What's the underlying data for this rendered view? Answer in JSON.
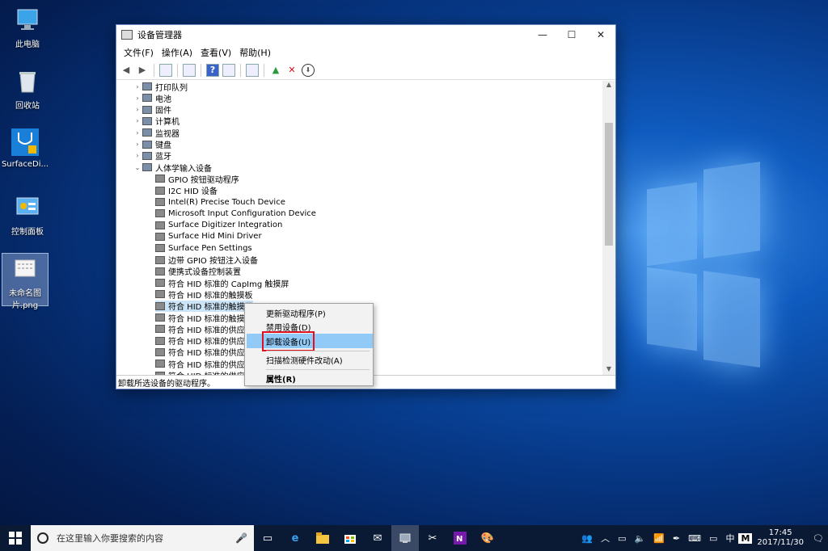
{
  "desktop": {
    "icons": [
      {
        "label": "此电脑",
        "icon": "computer-icon"
      },
      {
        "label": "回收站",
        "icon": "recycle-bin-icon"
      },
      {
        "label": "SurfaceDi...",
        "icon": "stethoscope-icon"
      },
      {
        "label": "控制面板",
        "icon": "control-panel-icon"
      },
      {
        "label": "未命名图片.png",
        "icon": "image-file-icon"
      }
    ]
  },
  "window": {
    "title": "设备管理器",
    "controls": {
      "minimize": "—",
      "maximize": "☐",
      "close": "✕"
    },
    "menu": [
      "文件(F)",
      "操作(A)",
      "查看(V)",
      "帮助(H)"
    ],
    "tree": [
      {
        "label": "打印队列",
        "level": 1,
        "expanded": false
      },
      {
        "label": "电池",
        "level": 1,
        "expanded": false
      },
      {
        "label": "固件",
        "level": 1,
        "expanded": false
      },
      {
        "label": "计算机",
        "level": 1,
        "expanded": false
      },
      {
        "label": "监视器",
        "level": 1,
        "expanded": false
      },
      {
        "label": "键盘",
        "level": 1,
        "expanded": false
      },
      {
        "label": "蓝牙",
        "level": 1,
        "expanded": false
      },
      {
        "label": "人体学输入设备",
        "level": 1,
        "expanded": true
      },
      {
        "label": "GPIO 按钮驱动程序",
        "level": 2
      },
      {
        "label": "I2C HID 设备",
        "level": 2
      },
      {
        "label": "Intel(R) Precise Touch Device",
        "level": 2
      },
      {
        "label": "Microsoft Input Configuration Device",
        "level": 2
      },
      {
        "label": "Surface Digitizer Integration",
        "level": 2
      },
      {
        "label": "Surface Hid Mini Driver",
        "level": 2
      },
      {
        "label": "Surface Pen Settings",
        "level": 2
      },
      {
        "label": "边带 GPIO 按钮注入设备",
        "level": 2
      },
      {
        "label": "便携式设备控制装置",
        "level": 2
      },
      {
        "label": "符合 HID 标准的 CapImg 触摸屏",
        "level": 2
      },
      {
        "label": "符合 HID 标准的触摸板",
        "level": 2
      },
      {
        "label": "符合 HID 标准的触摸屏",
        "level": 2,
        "selected": true
      },
      {
        "label": "符合 HID 标准的触摸屏",
        "level": 2
      },
      {
        "label": "符合 HID 标准的供应商",
        "level": 2
      },
      {
        "label": "符合 HID 标准的供应商",
        "level": 2
      },
      {
        "label": "符合 HID 标准的供应商",
        "level": 2
      },
      {
        "label": "符合 HID 标准的供应商",
        "level": 2
      },
      {
        "label": "符合 HID 标准的供应商",
        "level": 2
      }
    ],
    "status": "卸载所选设备的驱动程序。"
  },
  "context_menu": {
    "items": [
      {
        "label": "更新驱动程序(P)"
      },
      {
        "label": "禁用设备(D)"
      },
      {
        "label": "卸载设备(U)",
        "active": true
      },
      {
        "label": "扫描检测硬件改动(A)"
      },
      {
        "label": "属性(R)",
        "bold": true
      }
    ]
  },
  "taskbar": {
    "search_placeholder": "在这里输入你要搜索的内容",
    "apps": [
      "task-view-icon",
      "edge-icon",
      "file-explorer-icon",
      "store-icon",
      "mail-icon",
      "device-manager-icon",
      "snipping-icon",
      "onenote-icon",
      "paint-icon"
    ],
    "tray": {
      "ime": "中",
      "ime2": "M"
    },
    "time": "17:45",
    "date": "2017/11/30"
  },
  "colors": {
    "accent": "#0078d7",
    "highlight": "#91c9f7",
    "outline": "#e0101f"
  }
}
